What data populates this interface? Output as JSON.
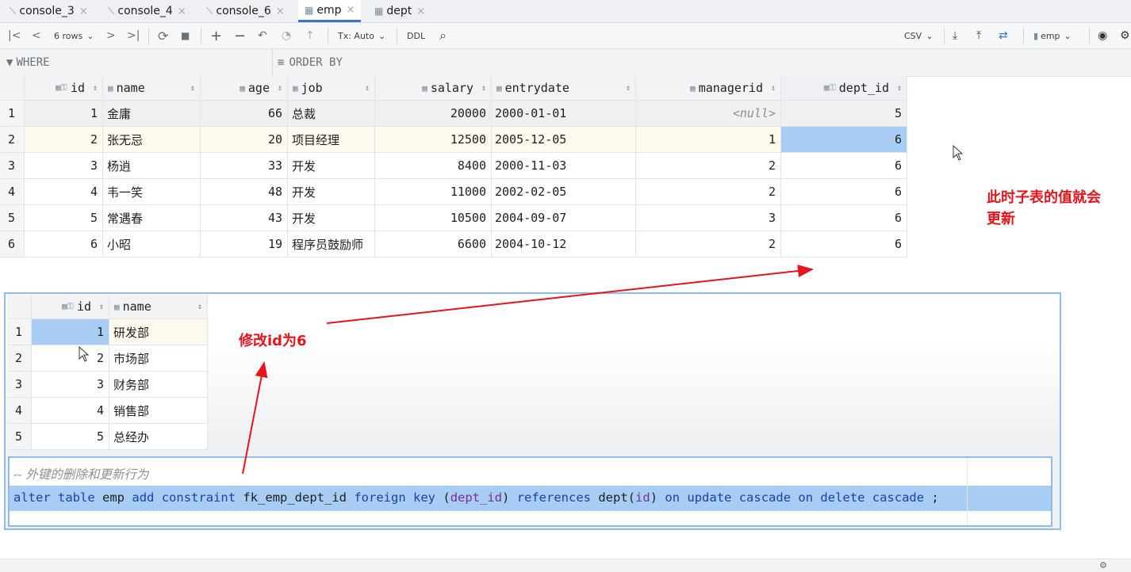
{
  "tabs": [
    {
      "label": "console_3",
      "icon": "console-icon",
      "active": false
    },
    {
      "label": "console_4",
      "icon": "console-icon",
      "active": false
    },
    {
      "label": "console_6",
      "icon": "console-icon",
      "active": false
    },
    {
      "label": "emp",
      "icon": "table-icon",
      "active": true
    },
    {
      "label": "dept",
      "icon": "table-icon",
      "active": false
    }
  ],
  "tab_close_glyph": "×",
  "toolbar": {
    "rows_label": "6 rows",
    "tx_label": "Tx: Auto",
    "ddl_label": "DDL",
    "export_label": "CSV",
    "table_selector": "emp"
  },
  "filter": {
    "where_label": "WHERE",
    "order_label": "ORDER BY"
  },
  "emp_table": {
    "columns": [
      "id",
      "name",
      "age",
      "job",
      "salary",
      "entrydate",
      "managerid",
      "dept_id"
    ],
    "rows": [
      {
        "rownum": "1",
        "id": "1",
        "name": "金庸",
        "age": "66",
        "job": "总裁",
        "salary": "20000",
        "entrydate": "2000-01-01",
        "managerid": "<null>",
        "dept_id": "5"
      },
      {
        "rownum": "2",
        "id": "2",
        "name": "张无忌",
        "age": "20",
        "job": "项目经理",
        "salary": "12500",
        "entrydate": "2005-12-05",
        "managerid": "1",
        "dept_id": "6"
      },
      {
        "rownum": "3",
        "id": "3",
        "name": "杨逍",
        "age": "33",
        "job": "开发",
        "salary": "8400",
        "entrydate": "2000-11-03",
        "managerid": "2",
        "dept_id": "6"
      },
      {
        "rownum": "4",
        "id": "4",
        "name": "韦一笑",
        "age": "48",
        "job": "开发",
        "salary": "11000",
        "entrydate": "2002-02-05",
        "managerid": "2",
        "dept_id": "6"
      },
      {
        "rownum": "5",
        "id": "5",
        "name": "常遇春",
        "age": "43",
        "job": "开发",
        "salary": "10500",
        "entrydate": "2004-09-07",
        "managerid": "3",
        "dept_id": "6"
      },
      {
        "rownum": "6",
        "id": "6",
        "name": "小昭",
        "age": "19",
        "job": "程序员鼓励师",
        "salary": "6600",
        "entrydate": "2004-10-12",
        "managerid": "2",
        "dept_id": "6"
      }
    ]
  },
  "dept_table": {
    "columns": [
      "id",
      "name"
    ],
    "rows": [
      {
        "rownum": "1",
        "id": "1",
        "name": "研发部"
      },
      {
        "rownum": "2",
        "id": "2",
        "name": "市场部"
      },
      {
        "rownum": "3",
        "id": "3",
        "name": "财务部"
      },
      {
        "rownum": "4",
        "id": "4",
        "name": "销售部"
      },
      {
        "rownum": "5",
        "id": "5",
        "name": "总经办"
      }
    ]
  },
  "sql": {
    "comment": "-- 外键的删除和更新行为",
    "tokens": [
      {
        "t": "alter",
        "c": "kw"
      },
      {
        "t": " ",
        "c": "plain"
      },
      {
        "t": "table",
        "c": "kw"
      },
      {
        "t": " emp ",
        "c": "plain"
      },
      {
        "t": "add",
        "c": "kw"
      },
      {
        "t": " ",
        "c": "plain"
      },
      {
        "t": "constraint",
        "c": "kw"
      },
      {
        "t": " fk_emp_dept_id ",
        "c": "plain"
      },
      {
        "t": "foreign",
        "c": "kw"
      },
      {
        "t": " ",
        "c": "plain"
      },
      {
        "t": "key",
        "c": "kw"
      },
      {
        "t": " (",
        "c": "plain"
      },
      {
        "t": "dept_id",
        "c": "id2"
      },
      {
        "t": ") ",
        "c": "plain"
      },
      {
        "t": "references",
        "c": "kw"
      },
      {
        "t": " dept(",
        "c": "plain"
      },
      {
        "t": "id",
        "c": "id2"
      },
      {
        "t": ") ",
        "c": "plain"
      },
      {
        "t": "on",
        "c": "kw"
      },
      {
        "t": " ",
        "c": "plain"
      },
      {
        "t": "update",
        "c": "kw"
      },
      {
        "t": " ",
        "c": "plain"
      },
      {
        "t": "cascade",
        "c": "kw"
      },
      {
        "t": " ",
        "c": "plain"
      },
      {
        "t": "on",
        "c": "kw"
      },
      {
        "t": " ",
        "c": "plain"
      },
      {
        "t": "delete",
        "c": "kw"
      },
      {
        "t": " ",
        "c": "plain"
      },
      {
        "t": "cascade",
        "c": "kw"
      },
      {
        "t": " ;",
        "c": "plain"
      }
    ]
  },
  "annotations": {
    "right_note_line1": "此时子表的值就会",
    "right_note_line2": "更新",
    "mid_note": "修改id为6"
  },
  "colors": {
    "annotation": "#e8141b",
    "selection": "#a8cdf5",
    "keyword": "#1c3fa8",
    "identifier": "#7a2c98"
  }
}
